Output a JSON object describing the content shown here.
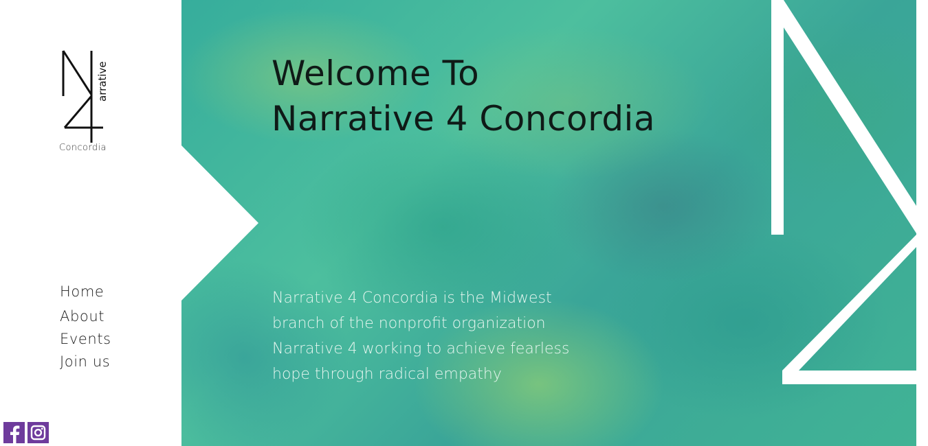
{
  "sidebar": {
    "logo": {
      "glyphs": "N4",
      "vertical_word": "arrative",
      "caption": "Concordia"
    },
    "nav": [
      {
        "label": "Home"
      },
      {
        "label": "About"
      },
      {
        "label": "Events"
      },
      {
        "label": "Join us"
      }
    ],
    "social": [
      {
        "icon": "facebook-icon",
        "color": "#6e3b9c"
      },
      {
        "icon": "instagram-icon",
        "color": "#6e3b9c"
      }
    ]
  },
  "hero": {
    "title_line1": "Welcome To",
    "title_line2": "Narrative 4 Concordia",
    "description": "Narrative 4 Concordia is the Midwest branch of the nonprofit organization Narrative 4 working to achieve fearless hope through radical empathy",
    "background_colors": [
      "#36ad9c",
      "#4dbf9e",
      "#9fd27e"
    ]
  },
  "colors": {
    "accent": "#6e3b9c",
    "text_dark": "#0f1a17",
    "text_light": "#e6f6ef"
  }
}
